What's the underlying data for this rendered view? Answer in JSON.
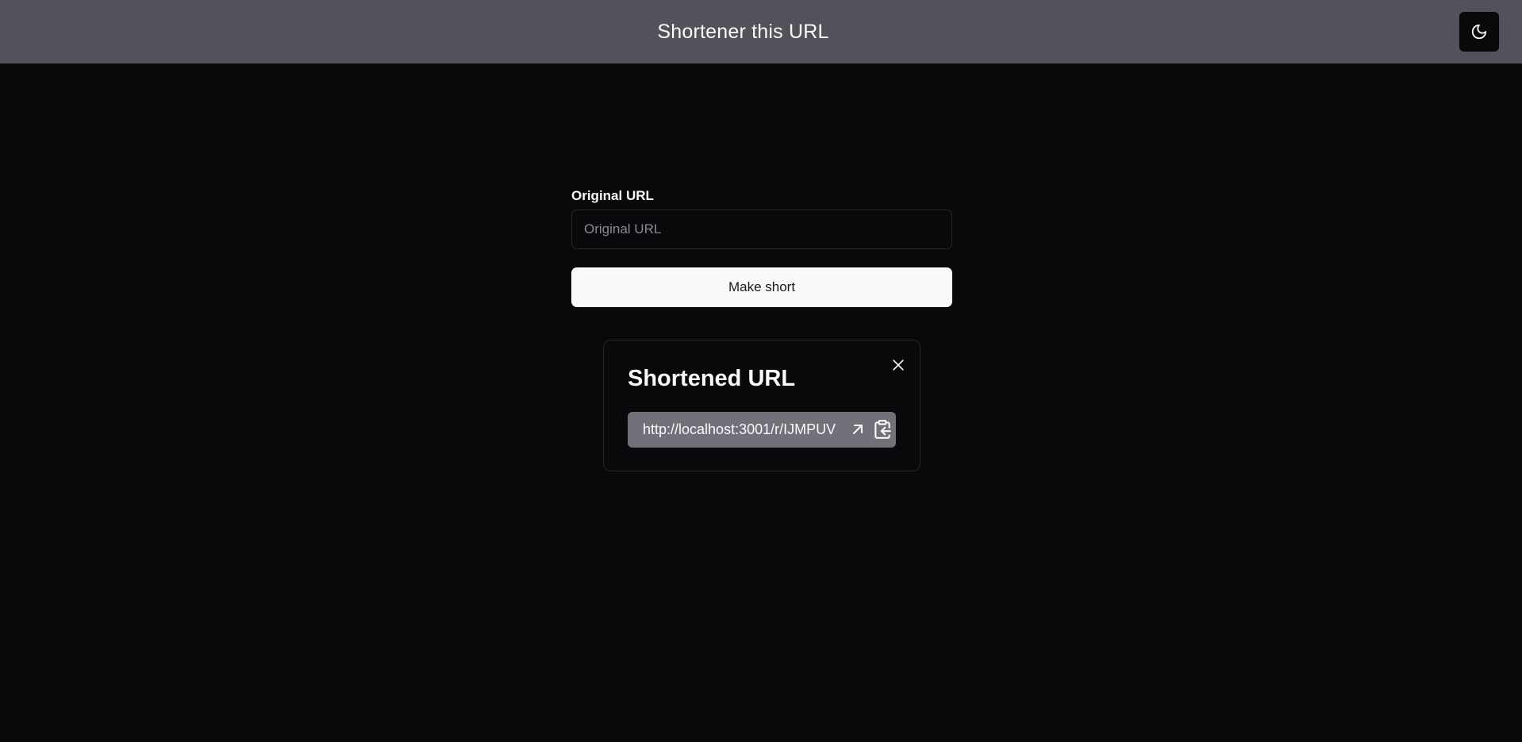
{
  "header": {
    "title": "Shortener this URL",
    "theme_toggle_icon": "moon-icon"
  },
  "form": {
    "label": "Original URL",
    "input_value": "",
    "input_placeholder": "Original URL",
    "submit_label": "Make short"
  },
  "result": {
    "title": "Shortened URL",
    "short_url": "http://localhost:3001/r/IJMPUV",
    "close_icon": "close-icon",
    "open_icon": "arrow-up-right-icon",
    "copy_icon": "clipboard-copy-icon"
  },
  "colors": {
    "background": "#09090b",
    "header": "#52525b",
    "button": "#fafafa",
    "link_box": "#71717a",
    "border": "#27272a"
  }
}
